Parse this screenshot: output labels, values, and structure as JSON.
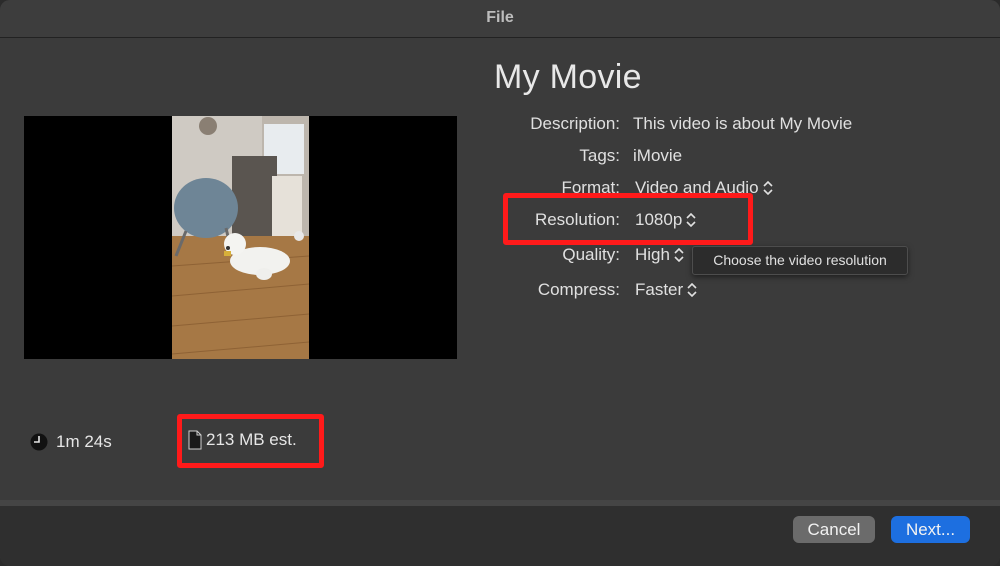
{
  "window": {
    "title": "File"
  },
  "movie": {
    "title": "My Movie"
  },
  "fields": {
    "description": {
      "label": "Description:",
      "value": "This video is about My Movie"
    },
    "tags": {
      "label": "Tags:",
      "value": "iMovie"
    },
    "format": {
      "label": "Format:",
      "value": "Video and Audio"
    },
    "resolution": {
      "label": "Resolution:",
      "value": "1080p"
    },
    "quality": {
      "label": "Quality:",
      "value": "High"
    },
    "compress": {
      "label": "Compress:",
      "value": "Faster"
    }
  },
  "tooltip": {
    "text": "Choose the video resolution"
  },
  "stats": {
    "duration": "1m 24s",
    "file_size": "213 MB est."
  },
  "buttons": {
    "cancel": "Cancel",
    "next": "Next..."
  },
  "icons": {
    "clock": "clock-icon",
    "file": "document-icon",
    "popup": "chevron-updown-icon"
  },
  "colors": {
    "accent": "#1d6fe0",
    "highlight": "#ff1a1a"
  }
}
